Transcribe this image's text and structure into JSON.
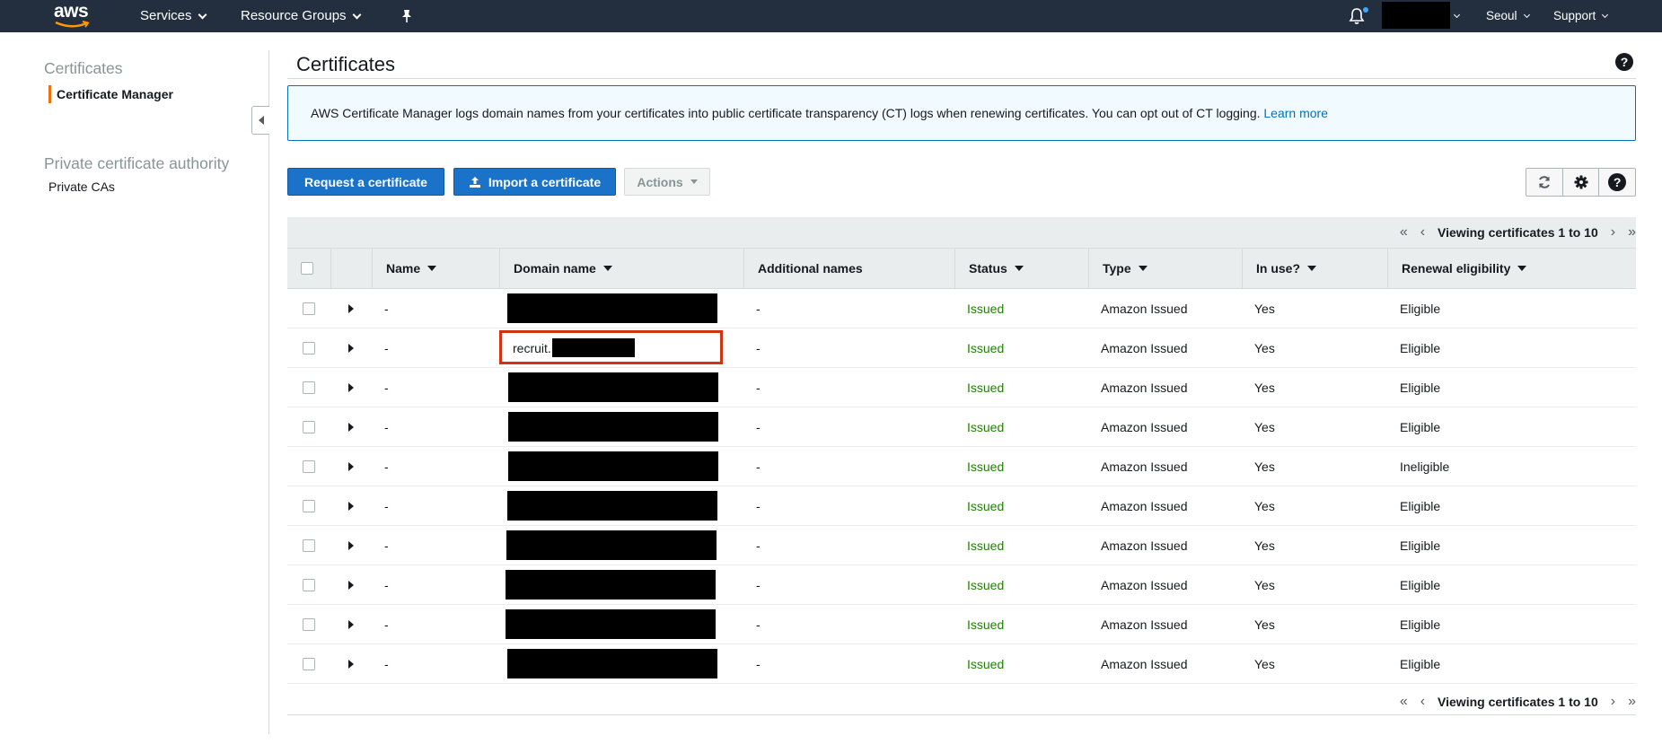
{
  "topnav": {
    "logo": "aws",
    "services_label": "Services",
    "resource_groups_label": "Resource Groups",
    "region_label": "Seoul",
    "support_label": "Support",
    "icons": [
      "pin-icon",
      "bell-icon"
    ]
  },
  "sidebar": {
    "heading_certificates": "Certificates",
    "certificate_manager": "Certificate Manager",
    "heading_private_ca": "Private certificate authority",
    "private_cas": "Private CAs"
  },
  "main": {
    "title": "Certificates",
    "info_text": "AWS Certificate Manager logs domain names from your certificates into public certificate transparency (CT) logs when renewing certificates. You can opt out of CT logging.",
    "info_link": "Learn more",
    "request_button": "Request a certificate",
    "import_button": "Import a certificate",
    "actions_button": "Actions",
    "pager_text": "Viewing certificates 1 to 10"
  },
  "table": {
    "headers": {
      "name": "Name",
      "domain": "Domain name",
      "additional": "Additional names",
      "status": "Status",
      "type": "Type",
      "in_use": "In use?",
      "renewal": "Renewal eligibility"
    },
    "highlighted_domain_prefix": "recruit.",
    "rows": [
      {
        "name": "-",
        "additional": "-",
        "status": "Issued",
        "type": "Amazon Issued",
        "in_use": "Yes",
        "renewal": "Eligible"
      },
      {
        "name": "-",
        "additional": "-",
        "status": "Issued",
        "type": "Amazon Issued",
        "in_use": "Yes",
        "renewal": "Eligible"
      },
      {
        "name": "-",
        "additional": "-",
        "status": "Issued",
        "type": "Amazon Issued",
        "in_use": "Yes",
        "renewal": "Eligible"
      },
      {
        "name": "-",
        "additional": "-",
        "status": "Issued",
        "type": "Amazon Issued",
        "in_use": "Yes",
        "renewal": "Eligible"
      },
      {
        "name": "-",
        "additional": "-",
        "status": "Issued",
        "type": "Amazon Issued",
        "in_use": "Yes",
        "renewal": "Ineligible"
      },
      {
        "name": "-",
        "additional": "-",
        "status": "Issued",
        "type": "Amazon Issued",
        "in_use": "Yes",
        "renewal": "Eligible"
      },
      {
        "name": "-",
        "additional": "-",
        "status": "Issued",
        "type": "Amazon Issued",
        "in_use": "Yes",
        "renewal": "Eligible"
      },
      {
        "name": "-",
        "additional": "-",
        "status": "Issued",
        "type": "Amazon Issued",
        "in_use": "Yes",
        "renewal": "Eligible"
      },
      {
        "name": "-",
        "additional": "-",
        "status": "Issued",
        "type": "Amazon Issued",
        "in_use": "Yes",
        "renewal": "Eligible"
      },
      {
        "name": "-",
        "additional": "-",
        "status": "Issued",
        "type": "Amazon Issued",
        "in_use": "Yes",
        "renewal": "Eligible"
      }
    ]
  },
  "colors": {
    "nav_bg": "#232f3e",
    "accent_orange": "#ec7211",
    "primary_blue": "#1a73c9",
    "link_blue": "#0073bb",
    "issued_green": "#1d8102",
    "highlight_red": "#d13212"
  }
}
